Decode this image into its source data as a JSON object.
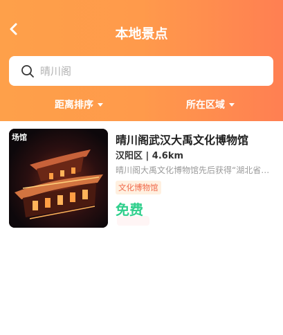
{
  "header": {
    "title": "本地景点",
    "back_icon": "chevron-left-icon"
  },
  "search": {
    "placeholder": "晴川阁",
    "icon": "search-icon"
  },
  "filters": {
    "sort_label": "距离排序",
    "area_label": "所在区域"
  },
  "results": [
    {
      "category_badge": "场馆",
      "name": "晴川阁武汉大禹文化博物馆",
      "meta": "汉阳区 | 4.6km",
      "description": "晴川阁大禹文化博物馆先后获得“湖北省文明单位”",
      "tag": "文化博物馆",
      "price": "免费"
    }
  ],
  "colors": {
    "header_gradient_start": "#fea04a",
    "header_gradient_end": "#ff7f52",
    "price_green": "#2fcf8c",
    "tag_text": "#f0694a",
    "tag_bg": "#fff0e0"
  }
}
